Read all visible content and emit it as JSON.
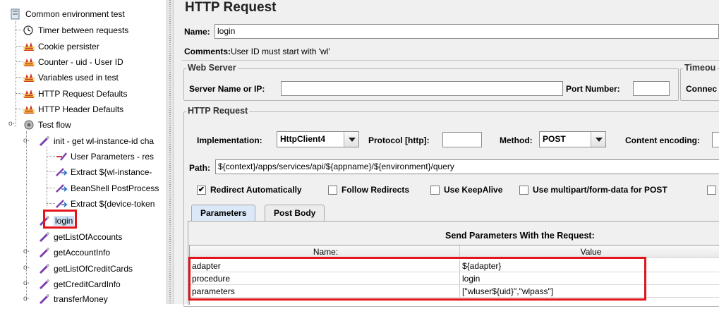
{
  "tree": {
    "items": [
      {
        "label": "Common environment test",
        "icon": "testplan-icon"
      },
      {
        "label": "Timer between requests",
        "icon": "timer-icon"
      },
      {
        "label": "Cookie persister",
        "icon": "config-element-icon"
      },
      {
        "label": "Counter - uid - User ID",
        "icon": "config-element-icon"
      },
      {
        "label": "Variables used in test",
        "icon": "config-element-icon"
      },
      {
        "label": "HTTP Request Defaults",
        "icon": "config-element-icon"
      },
      {
        "label": "HTTP Header Defaults",
        "icon": "config-element-icon"
      },
      {
        "label": "Test flow",
        "icon": "thread-group-icon"
      },
      {
        "label": "init - get wl-instance-id cha",
        "icon": "sampler-pipette-icon"
      },
      {
        "label": "User Parameters - res",
        "icon": "preprocessor-icon"
      },
      {
        "label": "Extract ${wl-instance-",
        "icon": "postprocessor-icon"
      },
      {
        "label": "BeanShell PostProcess",
        "icon": "postprocessor-icon"
      },
      {
        "label": "Extract ${device-token",
        "icon": "postprocessor-icon"
      },
      {
        "label": "login",
        "icon": "sampler-pipette-icon"
      },
      {
        "label": "getListOfAccounts",
        "icon": "sampler-pipette-icon"
      },
      {
        "label": "getAccountInfo",
        "icon": "sampler-pipette-icon"
      },
      {
        "label": "getListOfCreditCards",
        "icon": "sampler-pipette-icon"
      },
      {
        "label": "getCreditCardInfo",
        "icon": "sampler-pipette-icon"
      },
      {
        "label": "transferMoney",
        "icon": "sampler-pipette-icon"
      }
    ]
  },
  "panel": {
    "title": "HTTP Request",
    "name_label": "Name:",
    "name_value": "login",
    "comments_label": "Comments:",
    "comments_value": "User ID must start with 'wl'",
    "web_server": {
      "legend": "Web Server",
      "server_label": "Server Name or IP:",
      "server_value": "",
      "port_label": "Port Number:",
      "port_value": ""
    },
    "timeout": {
      "legend": "Timeou",
      "connect_label": "Connec"
    },
    "http_request": {
      "legend": "HTTP Request",
      "implementation_label": "Implementation:",
      "implementation_value": "HttpClient4",
      "protocol_label": "Protocol [http]:",
      "protocol_value": "",
      "method_label": "Method:",
      "method_value": "POST",
      "encoding_label": "Content encoding:",
      "path_label": "Path:",
      "path_value": "${context}/apps/services/api/${appname}/${environment}/query",
      "checkboxes": [
        {
          "label": "Redirect Automatically",
          "checked": true
        },
        {
          "label": "Follow Redirects",
          "checked": false
        },
        {
          "label": "Use KeepAlive",
          "checked": false
        },
        {
          "label": "Use multipart/form-data for POST",
          "checked": false
        }
      ]
    },
    "tabs": [
      {
        "label": "Parameters",
        "active": true
      },
      {
        "label": "Post Body",
        "active": false
      }
    ],
    "params": {
      "header": "Send Parameters With the Request:",
      "columns": [
        "Name:",
        "Value"
      ],
      "rows": [
        {
          "name": "adapter",
          "value": "${adapter}"
        },
        {
          "name": "procedure",
          "value": "login"
        },
        {
          "name": "parameters",
          "value": "[\"wluser${uid}\",\"wlpass\"]"
        }
      ]
    }
  },
  "colors": {
    "highlight_border": "#e3141b",
    "selected_tab": "#dbe8f7",
    "panel_background": "#f0f0f0"
  }
}
